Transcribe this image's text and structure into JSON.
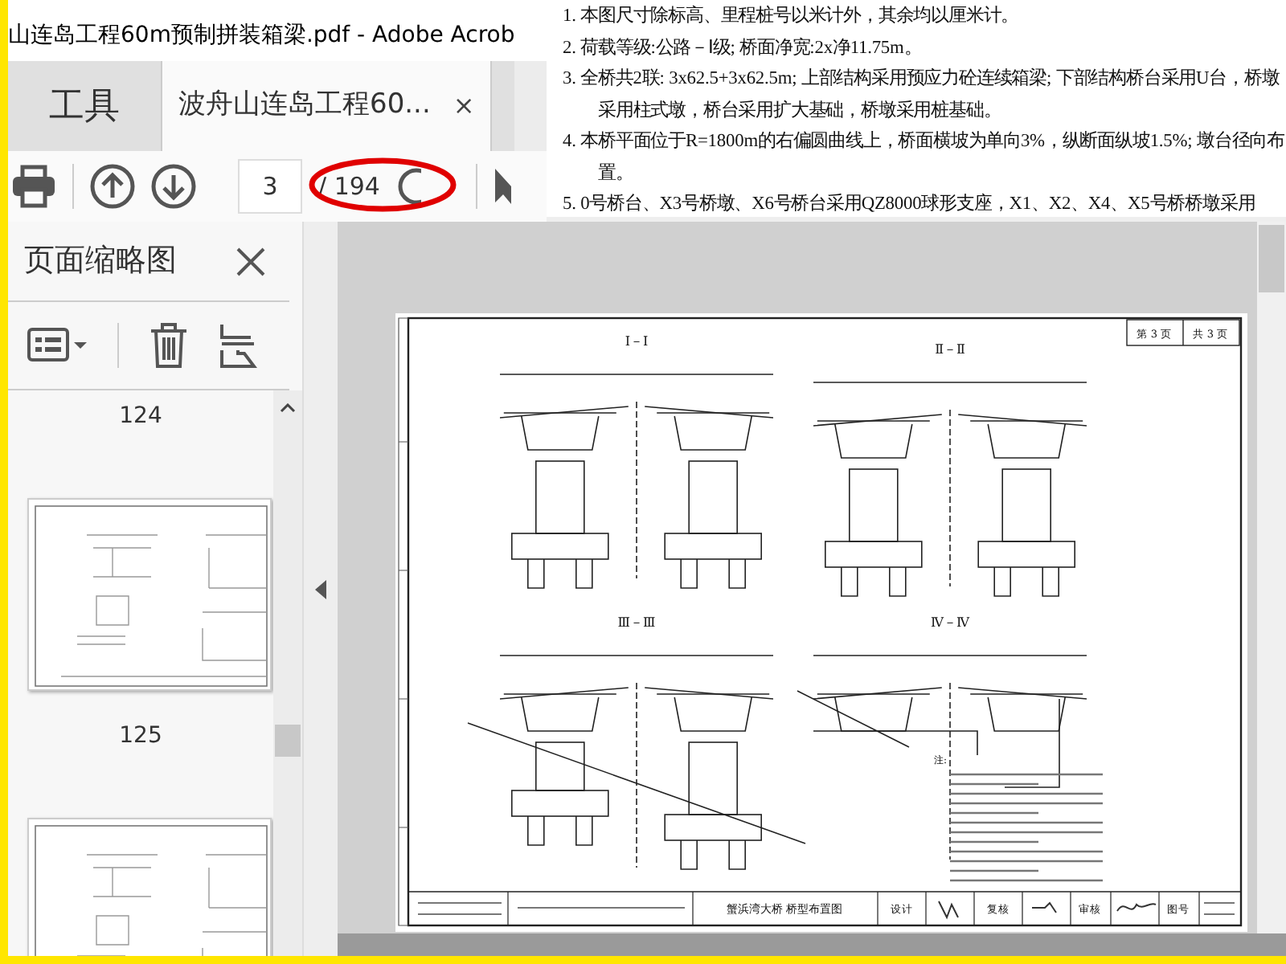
{
  "window": {
    "title": "山连岛工程60m预制拼装箱梁.pdf - Adobe Acrob"
  },
  "tabs": [
    {
      "label": "工具",
      "selected": false
    },
    {
      "label": "波舟山连岛工程60...",
      "selected": true,
      "close": "×"
    }
  ],
  "toolbar": {
    "page": "3",
    "page_count": "/ 194",
    "highlighted": true
  },
  "notes": [
    "1. 本图尺寸除标高、里程桩号以米计外，其余均以厘米计。",
    "2. 荷载等级:公路－Ⅰ级; 桥面净宽:2x净11.75m。",
    "3. 全桥共2联: 3x62.5+3x62.5m; 上部结构采用预应力砼连续箱梁; 下部结构桥台采用U台，桥墩采用柱式墩，桥台采用扩大基础，桥墩采用桩基础。",
    "4. 本桥平面位于R=1800m的右偏圆曲线上，桥面横坡为单向3%，纵断面纵坡1.5%; 墩台径向布置。",
    "5. 0号桥台、X3号桥墩、X6号桥台采用QZ8000球形支座，X1、X2、X4、X5号桥桥墩采用"
  ],
  "thumbnail_panel": {
    "title": "页面缩略图",
    "pages": [
      "124",
      "125"
    ]
  },
  "document": {
    "sheet": "第 3 页",
    "total": "共 3 页",
    "sections": [
      "Ⅰ－Ⅰ",
      "Ⅱ－Ⅱ",
      "Ⅲ－Ⅲ",
      "Ⅳ－Ⅳ"
    ],
    "notes_heading": "注:",
    "drawing_title": "蟹浜湾大桥 桥型布置图",
    "title_cells": [
      "设计",
      "复核",
      "审核",
      "图号"
    ]
  }
}
